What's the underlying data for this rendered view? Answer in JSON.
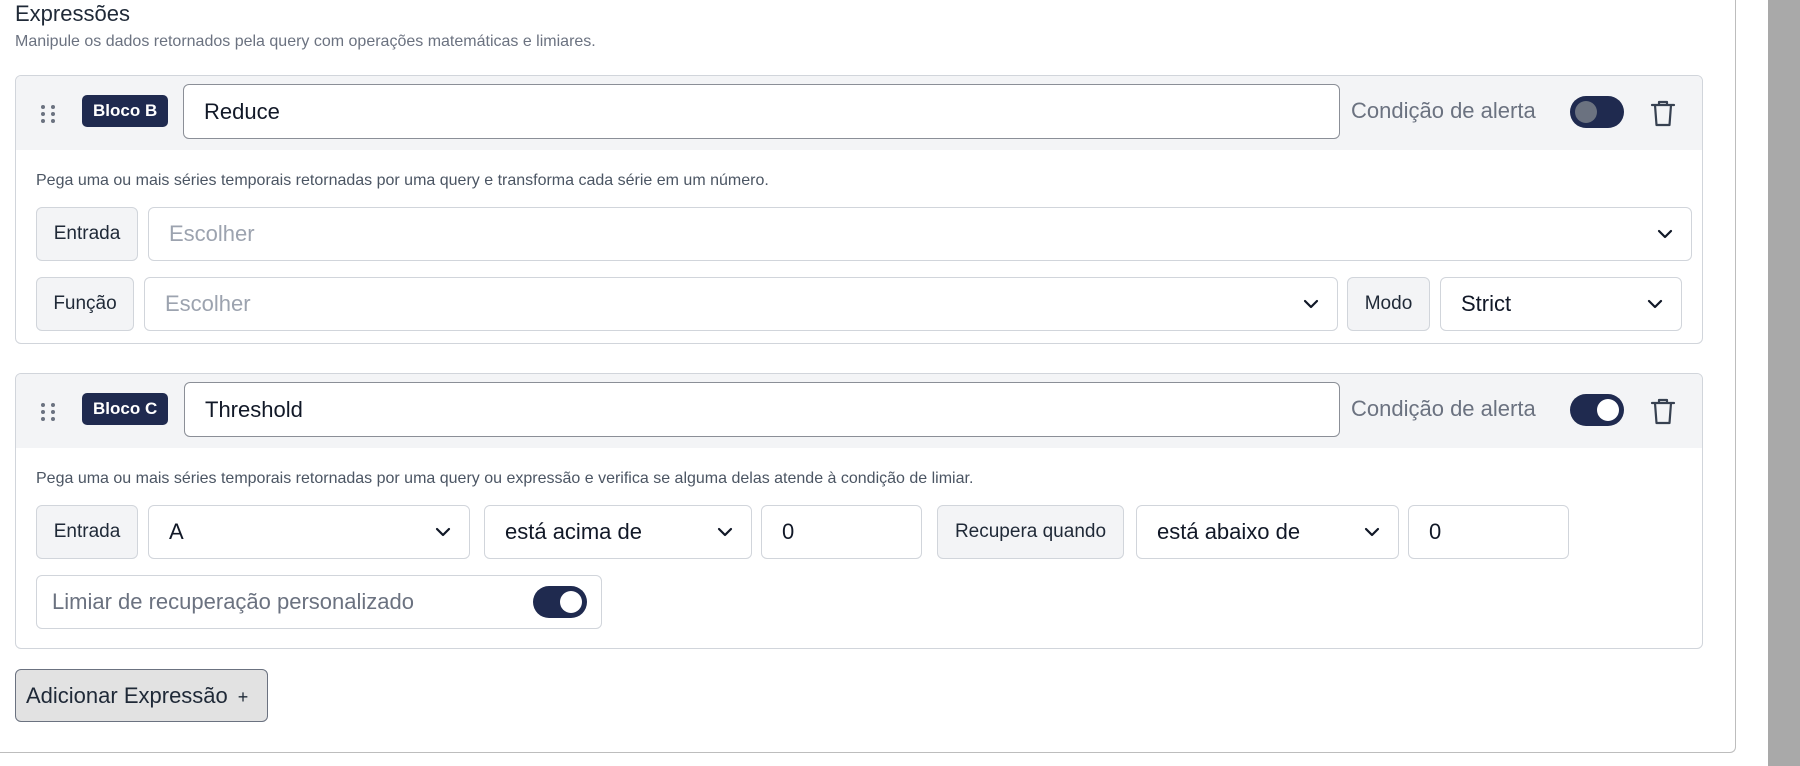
{
  "section": {
    "title": "Expressões",
    "subtitle": "Manipule os dados retornados pela query com operações matemáticas e limiares."
  },
  "blocks": [
    {
      "badge": "Bloco B",
      "name": "Reduce",
      "alert_label": "Condição de alerta",
      "alert_enabled": false,
      "description": "Pega uma ou mais séries temporais retornadas por uma query e transforma cada série em um número.",
      "input_label": "Entrada",
      "input_placeholder": "Escolher",
      "function_label": "Função",
      "function_placeholder": "Escolher",
      "mode_label": "Modo",
      "mode_value": "Strict"
    },
    {
      "badge": "Bloco C",
      "name": "Threshold",
      "alert_label": "Condição de alerta",
      "alert_enabled": true,
      "description": "Pega uma ou mais séries temporais retornadas por uma query ou expressão e verifica se alguma delas atende à condição de limiar.",
      "input_label": "Entrada",
      "input_value": "A",
      "condition_value": "está acima de",
      "threshold_value": "0",
      "recover_label": "Recupera quando",
      "recover_condition": "está abaixo de",
      "recover_value": "0",
      "custom_recovery_label": "Limiar de recuperação personalizado",
      "custom_recovery_enabled": true
    }
  ],
  "add_button": {
    "label": "Adicionar Expressão",
    "icon": "+"
  },
  "colors": {
    "badge_bg": "#1f2a4f",
    "toggle_bg": "#1f2a4f",
    "header_bg": "#f3f4f6"
  }
}
